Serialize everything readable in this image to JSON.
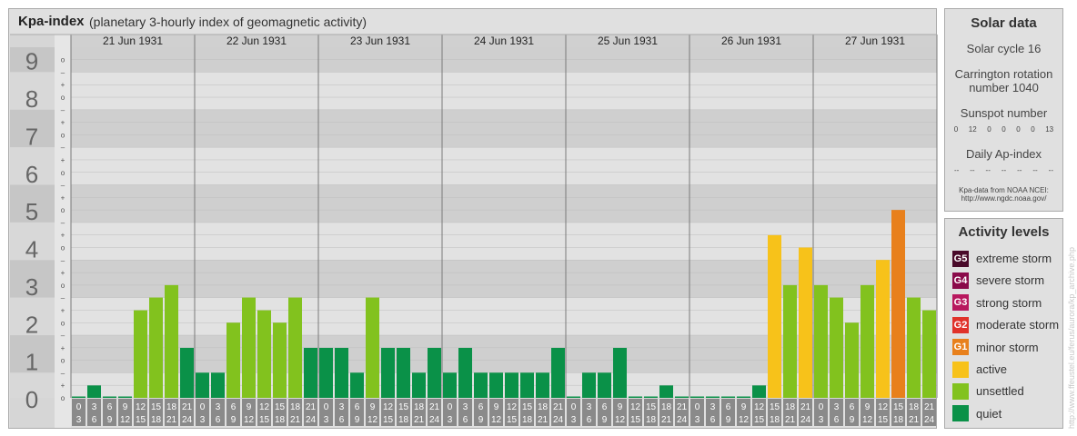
{
  "header": {
    "title": "Kpa-index",
    "subtitle": "(planetary 3-hourly index of geomagnetic activity)"
  },
  "solar": {
    "title": "Solar data",
    "cycle": "Solar cycle 16",
    "carrington_line1": "Carrington rotation",
    "carrington_line2": "number 1040",
    "sunspot_title": "Sunspot number",
    "sunspot_values": [
      "0",
      "12",
      "0",
      "0",
      "0",
      "0",
      "13"
    ],
    "ap_title": "Daily Ap-index",
    "ap_values": [
      "--",
      "--",
      "--",
      "--",
      "--",
      "--",
      "--"
    ],
    "source_line1": "Kpa-data from NOAA NCEI:",
    "source_line2": "http://www.ngdc.noaa.gov/"
  },
  "activity": {
    "title": "Activity levels",
    "items": [
      {
        "code": "G5",
        "label": "extreme storm",
        "color": "#4a0a2a"
      },
      {
        "code": "G4",
        "label": "severe storm",
        "color": "#8a0a4a"
      },
      {
        "code": "G3",
        "label": "strong storm",
        "color": "#b8185e"
      },
      {
        "code": "G2",
        "label": "moderate storm",
        "color": "#e0322a"
      },
      {
        "code": "G1",
        "label": "minor storm",
        "color": "#e8801c"
      },
      {
        "code": "",
        "label": "active",
        "color": "#f7c21a"
      },
      {
        "code": "",
        "label": "unsettled",
        "color": "#82c21e"
      },
      {
        "code": "",
        "label": "quiet",
        "color": "#0a9148"
      }
    ]
  },
  "credit": "http://www.ffeustel.eu/ferus/aurora/kp_archive.php",
  "chart_data": {
    "type": "bar",
    "days": [
      "21 Jun 1931",
      "22 Jun 1931",
      "23 Jun 1931",
      "24 Jun 1931",
      "25 Jun 1931",
      "26 Jun 1931",
      "27 Jun 1931"
    ],
    "y_labels": [
      "0",
      "1",
      "2",
      "3",
      "4",
      "5",
      "6",
      "7",
      "8",
      "9"
    ],
    "sub_labels": [
      "–",
      "+",
      "o"
    ],
    "ylim": [
      0,
      9.33
    ],
    "interval_starts": [
      "0",
      "3",
      "6",
      "9",
      "12",
      "15",
      "18",
      "21"
    ],
    "interval_ends": [
      "3",
      "6",
      "9",
      "12",
      "15",
      "18",
      "21",
      "24"
    ],
    "values": [
      [
        0,
        0.33,
        0,
        0,
        2.33,
        2.67,
        3,
        1.33
      ],
      [
        0.67,
        0.67,
        2,
        2.67,
        2.33,
        2,
        2.67,
        1.33
      ],
      [
        1.33,
        1.33,
        0.67,
        2.67,
        1.33,
        1.33,
        0.67,
        1.33
      ],
      [
        0.67,
        1.33,
        0.67,
        0.67,
        0.67,
        0.67,
        0.67,
        1.33
      ],
      [
        0,
        0.67,
        0.67,
        1.33,
        0,
        0,
        0.33,
        0
      ],
      [
        0,
        0,
        0,
        0,
        0.33,
        4.33,
        3,
        4
      ],
      [
        3,
        2.67,
        2,
        3,
        3.67,
        5,
        2.67,
        2.33
      ]
    ],
    "colors": {
      "quiet": "#0a9148",
      "unsettled": "#82c21e",
      "active": "#f7c21a",
      "minor_storm": "#e8801c"
    }
  }
}
